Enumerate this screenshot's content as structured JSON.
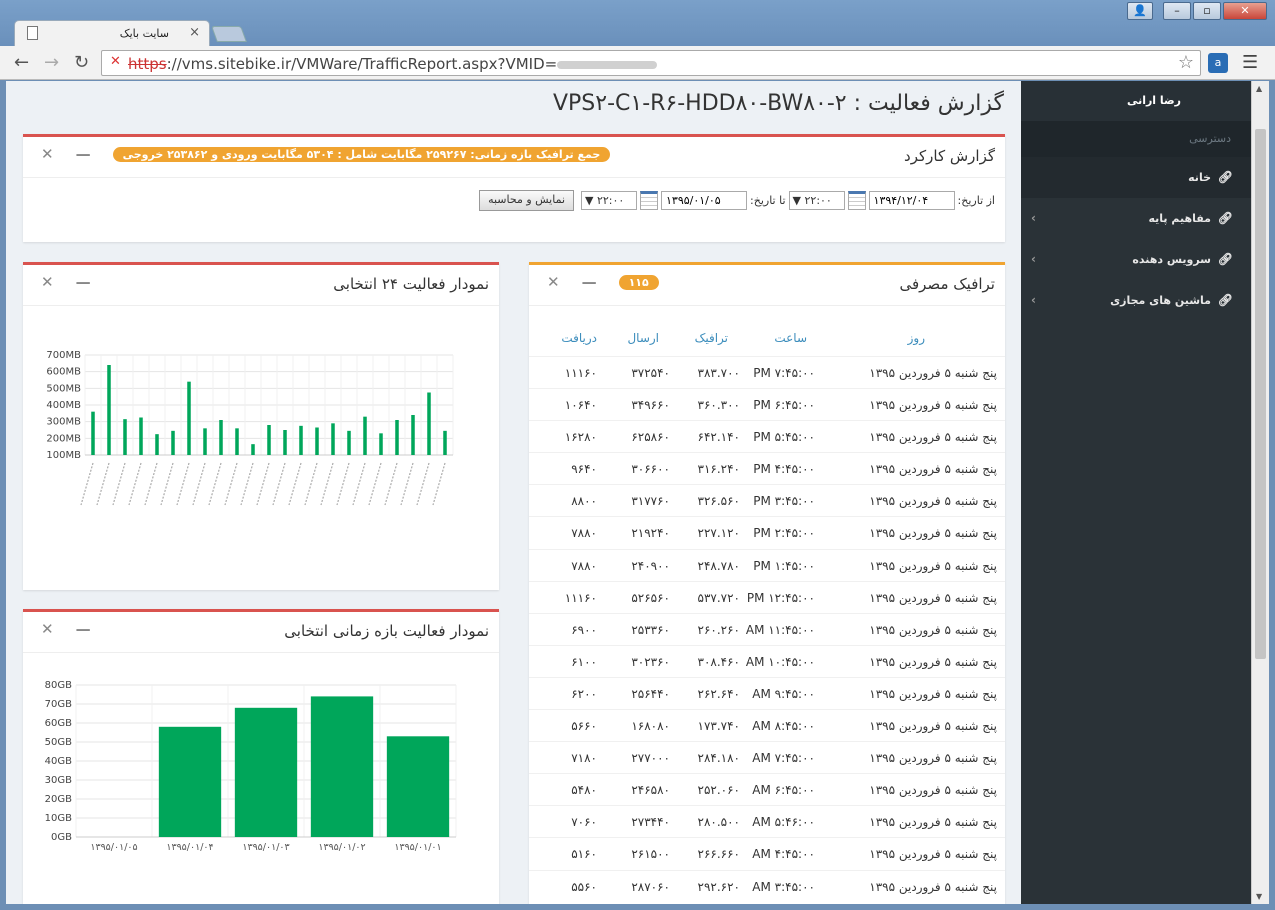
{
  "browser": {
    "tab_title": "سایت بایک",
    "tab_close": "×",
    "url_scheme": "https",
    "url_rest": "://vms.sitebike.ir/VMWare/TrafficReport.aspx?VMID=",
    "ext_label": "a"
  },
  "sidebar": {
    "user": "رضا ارانی",
    "section": "دسترسی",
    "items": [
      {
        "label": "خانه"
      },
      {
        "label": "مفاهیم پایه"
      },
      {
        "label": "سرویس دهنده"
      },
      {
        "label": "ماشین های مجازی"
      }
    ]
  },
  "page": {
    "title": "گزارش فعالیت : VPS۲-C۱-R۶-HDD۸۰-BW۸۰-۲"
  },
  "report_panel": {
    "title": "گزارش کارکرد",
    "badge": "جمع ترافیک بازه زمانی: ۲۵۹۲۶۷ مگابایت شامل : ۵۳۰۴ مگابایت ورودی و ۲۵۳۸۶۲ خروجی",
    "from_label": "از تاریخ:",
    "from_date": "۱۳۹۴/۱۲/۰۴",
    "from_time": "۲۲:۰۰",
    "to_label": "تا تاریخ:",
    "to_date": "۱۳۹۵/۰۱/۰۵",
    "to_time": "۲۲:۰۰",
    "button": "نمایش و محاسبه"
  },
  "traffic_panel": {
    "title": "ترافیک مصرفی",
    "badge": "۱۱۵",
    "columns": {
      "day": "روز",
      "time": "ساعت",
      "traffic": "ترافیک",
      "send": "ارسال",
      "recv": "دریافت"
    },
    "rows": [
      {
        "day": "پنج شنبه ۵ فروردین ۱۳۹۵",
        "time": "PM ۷:۴۵:۰۰",
        "traffic": "۳۸۳.۷۰۰",
        "send": "۳۷۲۵۴۰",
        "recv": "۱۱۱۶۰"
      },
      {
        "day": "پنج شنبه ۵ فروردین ۱۳۹۵",
        "time": "PM ۶:۴۵:۰۰",
        "traffic": "۳۶۰.۳۰۰",
        "send": "۳۴۹۶۶۰",
        "recv": "۱۰۶۴۰"
      },
      {
        "day": "پنج شنبه ۵ فروردین ۱۳۹۵",
        "time": "PM ۵:۴۵:۰۰",
        "traffic": "۶۴۲.۱۴۰",
        "send": "۶۲۵۸۶۰",
        "recv": "۱۶۲۸۰"
      },
      {
        "day": "پنج شنبه ۵ فروردین ۱۳۹۵",
        "time": "PM ۴:۴۵:۰۰",
        "traffic": "۳۱۶.۲۴۰",
        "send": "۳۰۶۶۰۰",
        "recv": "۹۶۴۰"
      },
      {
        "day": "پنج شنبه ۵ فروردین ۱۳۹۵",
        "time": "PM ۳:۴۵:۰۰",
        "traffic": "۳۲۶.۵۶۰",
        "send": "۳۱۷۷۶۰",
        "recv": "۸۸۰۰"
      },
      {
        "day": "پنج شنبه ۵ فروردین ۱۳۹۵",
        "time": "PM ۲:۴۵:۰۰",
        "traffic": "۲۲۷.۱۲۰",
        "send": "۲۱۹۲۴۰",
        "recv": "۷۸۸۰"
      },
      {
        "day": "پنج شنبه ۵ فروردین ۱۳۹۵",
        "time": "PM ۱:۴۵:۰۰",
        "traffic": "۲۴۸.۷۸۰",
        "send": "۲۴۰۹۰۰",
        "recv": "۷۸۸۰"
      },
      {
        "day": "پنج شنبه ۵ فروردین ۱۳۹۵",
        "time": "PM ۱۲:۴۵:۰۰",
        "traffic": "۵۳۷.۷۲۰",
        "send": "۵۲۶۵۶۰",
        "recv": "۱۱۱۶۰"
      },
      {
        "day": "پنج شنبه ۵ فروردین ۱۳۹۵",
        "time": "AM ۱۱:۴۵:۰۰",
        "traffic": "۲۶۰.۲۶۰",
        "send": "۲۵۳۳۶۰",
        "recv": "۶۹۰۰"
      },
      {
        "day": "پنج شنبه ۵ فروردین ۱۳۹۵",
        "time": "AM ۱۰:۴۵:۰۰",
        "traffic": "۳۰۸.۴۶۰",
        "send": "۳۰۲۳۶۰",
        "recv": "۶۱۰۰"
      },
      {
        "day": "پنج شنبه ۵ فروردین ۱۳۹۵",
        "time": "AM ۹:۴۵:۰۰",
        "traffic": "۲۶۲.۶۴۰",
        "send": "۲۵۶۴۴۰",
        "recv": "۶۲۰۰"
      },
      {
        "day": "پنج شنبه ۵ فروردین ۱۳۹۵",
        "time": "AM ۸:۴۵:۰۰",
        "traffic": "۱۷۳.۷۴۰",
        "send": "۱۶۸۰۸۰",
        "recv": "۵۶۶۰"
      },
      {
        "day": "پنج شنبه ۵ فروردین ۱۳۹۵",
        "time": "AM ۷:۴۵:۰۰",
        "traffic": "۲۸۴.۱۸۰",
        "send": "۲۷۷۰۰۰",
        "recv": "۷۱۸۰"
      },
      {
        "day": "پنج شنبه ۵ فروردین ۱۳۹۵",
        "time": "AM ۶:۴۵:۰۰",
        "traffic": "۲۵۲.۰۶۰",
        "send": "۲۴۶۵۸۰",
        "recv": "۵۴۸۰"
      },
      {
        "day": "پنج شنبه ۵ فروردین ۱۳۹۵",
        "time": "AM ۵:۴۶:۰۰",
        "traffic": "۲۸۰.۵۰۰",
        "send": "۲۷۳۴۴۰",
        "recv": "۷۰۶۰"
      },
      {
        "day": "پنج شنبه ۵ فروردین ۱۳۹۵",
        "time": "AM ۴:۴۵:۰۰",
        "traffic": "۲۶۶.۶۶۰",
        "send": "۲۶۱۵۰۰",
        "recv": "۵۱۶۰"
      },
      {
        "day": "پنج شنبه ۵ فروردین ۱۳۹۵",
        "time": "AM ۳:۴۵:۰۰",
        "traffic": "۲۹۲.۶۲۰",
        "send": "۲۸۷۰۶۰",
        "recv": "۵۵۶۰"
      }
    ]
  },
  "chart24_panel": {
    "title": "نمودار فعالیت ۲۴ انتخابی"
  },
  "range_panel": {
    "title": "نمودار فعالیت بازه زمانی انتخابی"
  },
  "chart_data": [
    {
      "type": "bar",
      "title": "",
      "yticks": [
        "100MB",
        "200MB",
        "300MB",
        "400MB",
        "500MB",
        "600MB",
        "700MB"
      ],
      "ylim": [
        100,
        700
      ],
      "values": [
        360,
        640,
        315,
        325,
        225,
        245,
        540,
        260,
        310,
        260,
        165,
        280,
        250,
        275,
        265,
        290,
        245,
        330,
        230,
        310,
        340,
        475,
        245
      ],
      "color": "#00a65a",
      "grid": true
    },
    {
      "type": "bar",
      "title": "",
      "categories": [
        "۱۳۹۵/۰۱/۰۵",
        "۱۳۹۵/۰۱/۰۴",
        "۱۳۹۵/۰۱/۰۳",
        "۱۳۹۵/۰۱/۰۲",
        "۱۳۹۵/۰۱/۰۱"
      ],
      "values": [
        0,
        58,
        68,
        74,
        53
      ],
      "yticks": [
        "0GB",
        "10GB",
        "20GB",
        "30GB",
        "40GB",
        "50GB",
        "60GB",
        "70GB",
        "80GB"
      ],
      "ylim": [
        0,
        80
      ],
      "color": "#00a65a",
      "grid": true
    }
  ]
}
